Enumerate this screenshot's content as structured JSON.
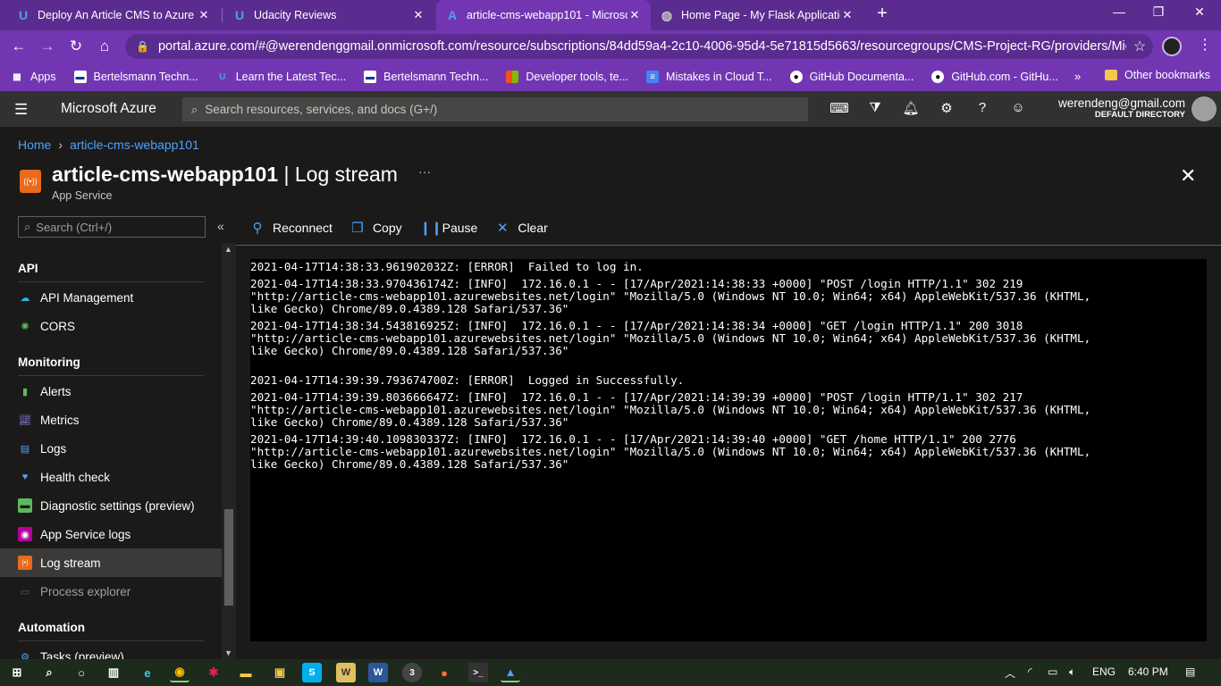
{
  "browser": {
    "tabs": [
      {
        "title": "Deploy An Article CMS to Azure -",
        "icon": "udacity-icon",
        "active": false
      },
      {
        "title": "Udacity Reviews",
        "icon": "udacity-icon",
        "active": false
      },
      {
        "title": "article-cms-webapp101 - Microso",
        "icon": "azure-icon",
        "active": true
      },
      {
        "title": "Home Page - My Flask Applicatio",
        "icon": "globe-icon",
        "active": false
      }
    ],
    "url": "portal.azure.com/#@werendenggmail.onmicrosoft.com/resource/subscriptions/84dd59a4-2c10-4006-95d4-5e71815d5663/resourcegroups/CMS-Project-RG/providers/Micr...",
    "bookmarks": [
      {
        "label": "Apps",
        "icon": "apps-grid-icon"
      },
      {
        "label": "Bertelsmann Techn...",
        "icon": "bertelsmann-icon"
      },
      {
        "label": "Learn the Latest Tec...",
        "icon": "udacity-icon"
      },
      {
        "label": "Bertelsmann Techn...",
        "icon": "bertelsmann-icon"
      },
      {
        "label": "Developer tools, te...",
        "icon": "microsoft-icon"
      },
      {
        "label": "Mistakes in Cloud T...",
        "icon": "docs-icon"
      },
      {
        "label": "GitHub Documenta...",
        "icon": "github-icon"
      },
      {
        "label": "GitHub.com - GitHu...",
        "icon": "github-icon"
      }
    ],
    "bookmarks_more": "»",
    "other_bookmarks": "Other bookmarks",
    "colors": {
      "frame": "#5b2c8f",
      "toolbar": "#7236b3"
    }
  },
  "azure": {
    "brand": "Microsoft Azure",
    "search_placeholder": "Search resources, services, and docs (G+/)",
    "account_email": "werendeng@gmail.com",
    "account_directory": "DEFAULT DIRECTORY"
  },
  "breadcrumb": [
    "Home",
    "article-cms-webapp101"
  ],
  "resource": {
    "name": "article-cms-webapp101",
    "separator": " | ",
    "blade": "Log stream",
    "type": "App Service"
  },
  "sidenav": {
    "search_placeholder": "Search (Ctrl+/)",
    "sections": [
      {
        "heading": "API",
        "items": [
          {
            "label": "API Management",
            "icon": "api-management-icon",
            "color": "#2bb5e8"
          },
          {
            "label": "CORS",
            "icon": "cors-icon",
            "color": "#5cb85c"
          }
        ]
      },
      {
        "heading": "Monitoring",
        "items": [
          {
            "label": "Alerts",
            "icon": "alerts-icon",
            "color": "#5cb85c"
          },
          {
            "label": "Metrics",
            "icon": "metrics-icon",
            "color": "#8a7fd6"
          },
          {
            "label": "Logs",
            "icon": "logs-icon",
            "color": "#4ea1ff"
          },
          {
            "label": "Health check",
            "icon": "health-check-icon",
            "color": "#4ea1ff"
          },
          {
            "label": "Diagnostic settings (preview)",
            "icon": "diagnostic-settings-icon",
            "color": "#5cb85c"
          },
          {
            "label": "App Service logs",
            "icon": "app-service-logs-icon",
            "color": "#b4009e"
          },
          {
            "label": "Log stream",
            "icon": "log-stream-icon",
            "color": "#e86b1b",
            "selected": true
          },
          {
            "label": "Process explorer",
            "icon": "process-explorer-icon",
            "color": "#605e5c",
            "dim": true
          }
        ]
      },
      {
        "heading": "Automation",
        "items": [
          {
            "label": "Tasks (preview)",
            "icon": "tasks-icon",
            "color": "#4ea1ff"
          }
        ]
      }
    ]
  },
  "toolbar": {
    "reconnect": "Reconnect",
    "copy": "Copy",
    "pause": "Pause",
    "clear": "Clear"
  },
  "log_lines": [
    "2021-04-17T14:38:33.961902032Z: [ERROR]  Failed to log in.",
    "2021-04-17T14:38:33.970436174Z: [INFO]  172.16.0.1 - - [17/Apr/2021:14:38:33 +0000] \"POST /login HTTP/1.1\" 302 219\n\"http://article-cms-webapp101.azurewebsites.net/login\" \"Mozilla/5.0 (Windows NT 10.0; Win64; x64) AppleWebKit/537.36 (KHTML,\nlike Gecko) Chrome/89.0.4389.128 Safari/537.36\"",
    "2021-04-17T14:38:34.543816925Z: [INFO]  172.16.0.1 - - [17/Apr/2021:14:38:34 +0000] \"GET /login HTTP/1.1\" 200 3018\n\"http://article-cms-webapp101.azurewebsites.net/login\" \"Mozilla/5.0 (Windows NT 10.0; Win64; x64) AppleWebKit/537.36 (KHTML,\nlike Gecko) Chrome/89.0.4389.128 Safari/537.36\"",
    "\n2021-04-17T14:39:39.793674700Z: [ERROR]  Logged in Successfully.",
    "2021-04-17T14:39:39.803666647Z: [INFO]  172.16.0.1 - - [17/Apr/2021:14:39:39 +0000] \"POST /login HTTP/1.1\" 302 217\n\"http://article-cms-webapp101.azurewebsites.net/login\" \"Mozilla/5.0 (Windows NT 10.0; Win64; x64) AppleWebKit/537.36 (KHTML,\nlike Gecko) Chrome/89.0.4389.128 Safari/537.36\"",
    "2021-04-17T14:39:40.109830337Z: [INFO]  172.16.0.1 - - [17/Apr/2021:14:39:40 +0000] \"GET /home HTTP/1.1\" 200 2776\n\"http://article-cms-webapp101.azurewebsites.net/login\" \"Mozilla/5.0 (Windows NT 10.0; Win64; x64) AppleWebKit/537.36 (KHTML,\nlike Gecko) Chrome/89.0.4389.128 Safari/537.36\""
  ],
  "taskbar": {
    "language": "ENG",
    "time": "6:40 PM"
  }
}
